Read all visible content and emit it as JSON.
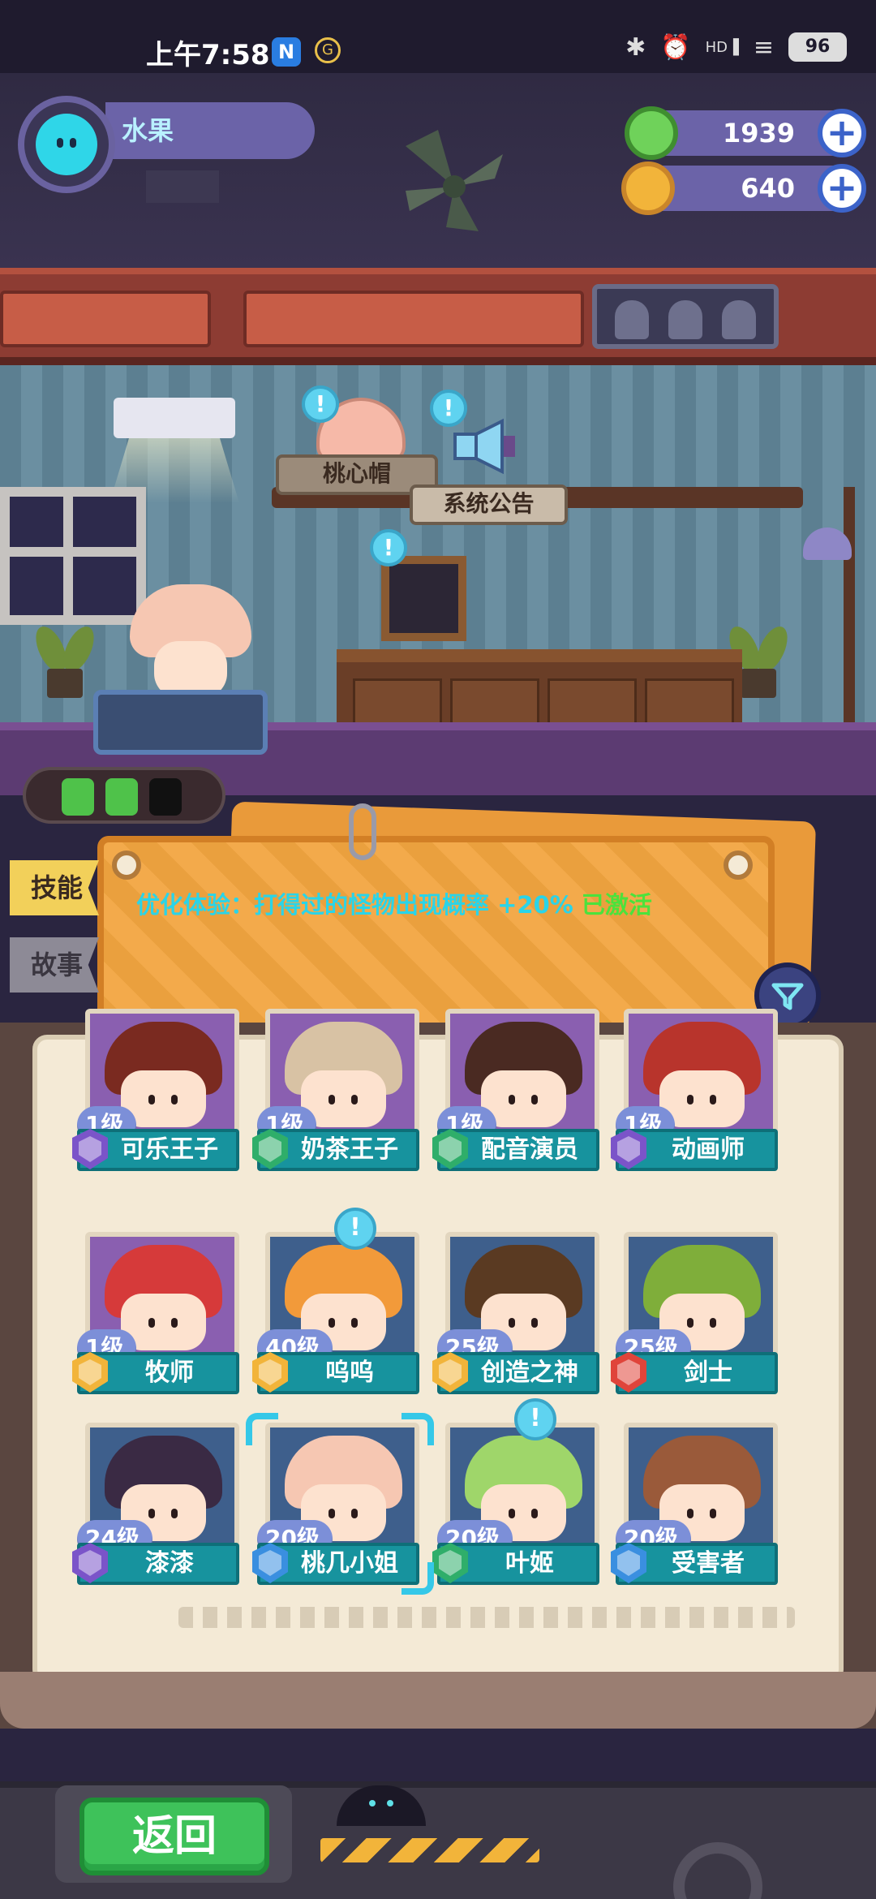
{
  "status_bar": {
    "time": "上午7:58",
    "app_badge_1": "N",
    "app_badge_2": "G",
    "icons": [
      "bluetooth-icon",
      "alarm-icon",
      "signal-icon",
      "wifi-icon"
    ],
    "signal_label": "HD",
    "battery": "96"
  },
  "player": {
    "name": "水果",
    "avatar_color": "#2fd6e8"
  },
  "resources": [
    {
      "name": "donut-currency-icon",
      "value": "1939",
      "color": "#6fd25a"
    },
    {
      "name": "planet-currency-icon",
      "value": "640",
      "color": "#f2b43a"
    }
  ],
  "scene": {
    "hat_label": "桃心帽",
    "notice_label": "系统公告",
    "bubble_mark": "!"
  },
  "energy": {
    "filled": 2,
    "total": 3
  },
  "board": {
    "skill_text": "优化体验：打得过的怪物出现概率 +20%",
    "skill_status": "已激活",
    "tabs": [
      "技能",
      "故事"
    ]
  },
  "characters": [
    {
      "level": "1级",
      "name": "可乐王子",
      "badge": "#7b54c9",
      "hair": "#7a2a20",
      "frame": "purple"
    },
    {
      "level": "1级",
      "name": "奶茶王子",
      "badge": "#2fae6a",
      "hair": "#d8c2a4",
      "frame": "purple"
    },
    {
      "level": "1级",
      "name": "配音演员",
      "badge": "#2fae6a",
      "hair": "#4a2a22",
      "frame": "purple"
    },
    {
      "level": "1级",
      "name": "动画师",
      "badge": "#7b54c9",
      "hair": "#b8342c",
      "frame": "purple"
    },
    {
      "level": "1级",
      "name": "牧师",
      "badge": "#f2b43a",
      "hair": "#d63a3a",
      "frame": "purple"
    },
    {
      "level": "40级",
      "name": "呜呜",
      "badge": "#f2b43a",
      "hair": "#f29a3a",
      "frame": "blue"
    },
    {
      "level": "25级",
      "name": "创造之神",
      "badge": "#f2b43a",
      "hair": "#5a3a22",
      "frame": "blue"
    },
    {
      "level": "25级",
      "name": "剑士",
      "badge": "#e0443a",
      "hair": "#7fae3a",
      "frame": "blue"
    },
    {
      "level": "24级",
      "name": "漆漆",
      "badge": "#7b54c9",
      "hair": "#3a2a44",
      "frame": "blue"
    },
    {
      "level": "20级",
      "name": "桃几小姐",
      "badge": "#3a8fe0",
      "hair": "#f6c7b2",
      "frame": "blue"
    },
    {
      "level": "20级",
      "name": "叶姬",
      "badge": "#2fae6a",
      "hair": "#9fd66a",
      "frame": "blue"
    },
    {
      "level": "20级",
      "name": "受害者",
      "badge": "#3a8fe0",
      "hair": "#9a5a3a",
      "frame": "blue"
    }
  ],
  "footer": {
    "back_label": "返回"
  }
}
